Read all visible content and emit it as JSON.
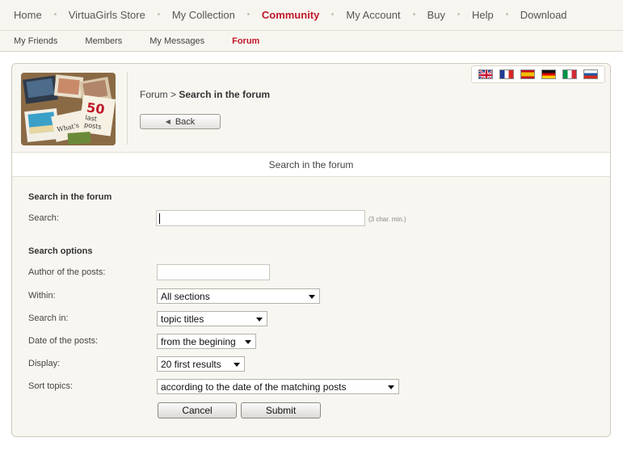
{
  "topnav": {
    "items": [
      {
        "label": "Home"
      },
      {
        "label": "VirtuaGirls Store"
      },
      {
        "label": "My Collection"
      },
      {
        "label": "Community",
        "active": true
      },
      {
        "label": "My Account"
      },
      {
        "label": "Buy"
      },
      {
        "label": "Help"
      },
      {
        "label": "Download"
      }
    ]
  },
  "subnav": {
    "items": [
      {
        "label": "My Friends"
      },
      {
        "label": "Members"
      },
      {
        "label": "My Messages"
      },
      {
        "label": "Forum",
        "active": true
      }
    ]
  },
  "flags": [
    "english-flag-icon",
    "french-flag-icon",
    "spanish-flag-icon",
    "german-flag-icon",
    "italian-flag-icon",
    "russian-flag-icon"
  ],
  "breadcrumb": {
    "parent": "Forum",
    "separator": ">",
    "current": "Search in the forum"
  },
  "back_label": "Back",
  "section_title": "Search in the forum",
  "search_section": {
    "heading": "Search in the forum",
    "search_label": "Search:",
    "search_value": "",
    "hint": "(3 char. min.)"
  },
  "options": {
    "heading": "Search options",
    "author_label": "Author of the posts:",
    "author_value": "",
    "within_label": "Within:",
    "within_value": "All sections",
    "search_in_label": "Search in:",
    "search_in_value": "topic titles",
    "date_label": "Date of the posts:",
    "date_value": "from the begining",
    "display_label": "Display:",
    "display_value": "20 first results",
    "sort_label": "Sort topics:",
    "sort_value": "according to the date of the matching posts"
  },
  "buttons": {
    "cancel": "Cancel",
    "submit": "Submit"
  },
  "colors": {
    "accent": "#c0182a",
    "panel_bg": "#f8f6f1",
    "nav_bg": "#f7f5ef"
  }
}
